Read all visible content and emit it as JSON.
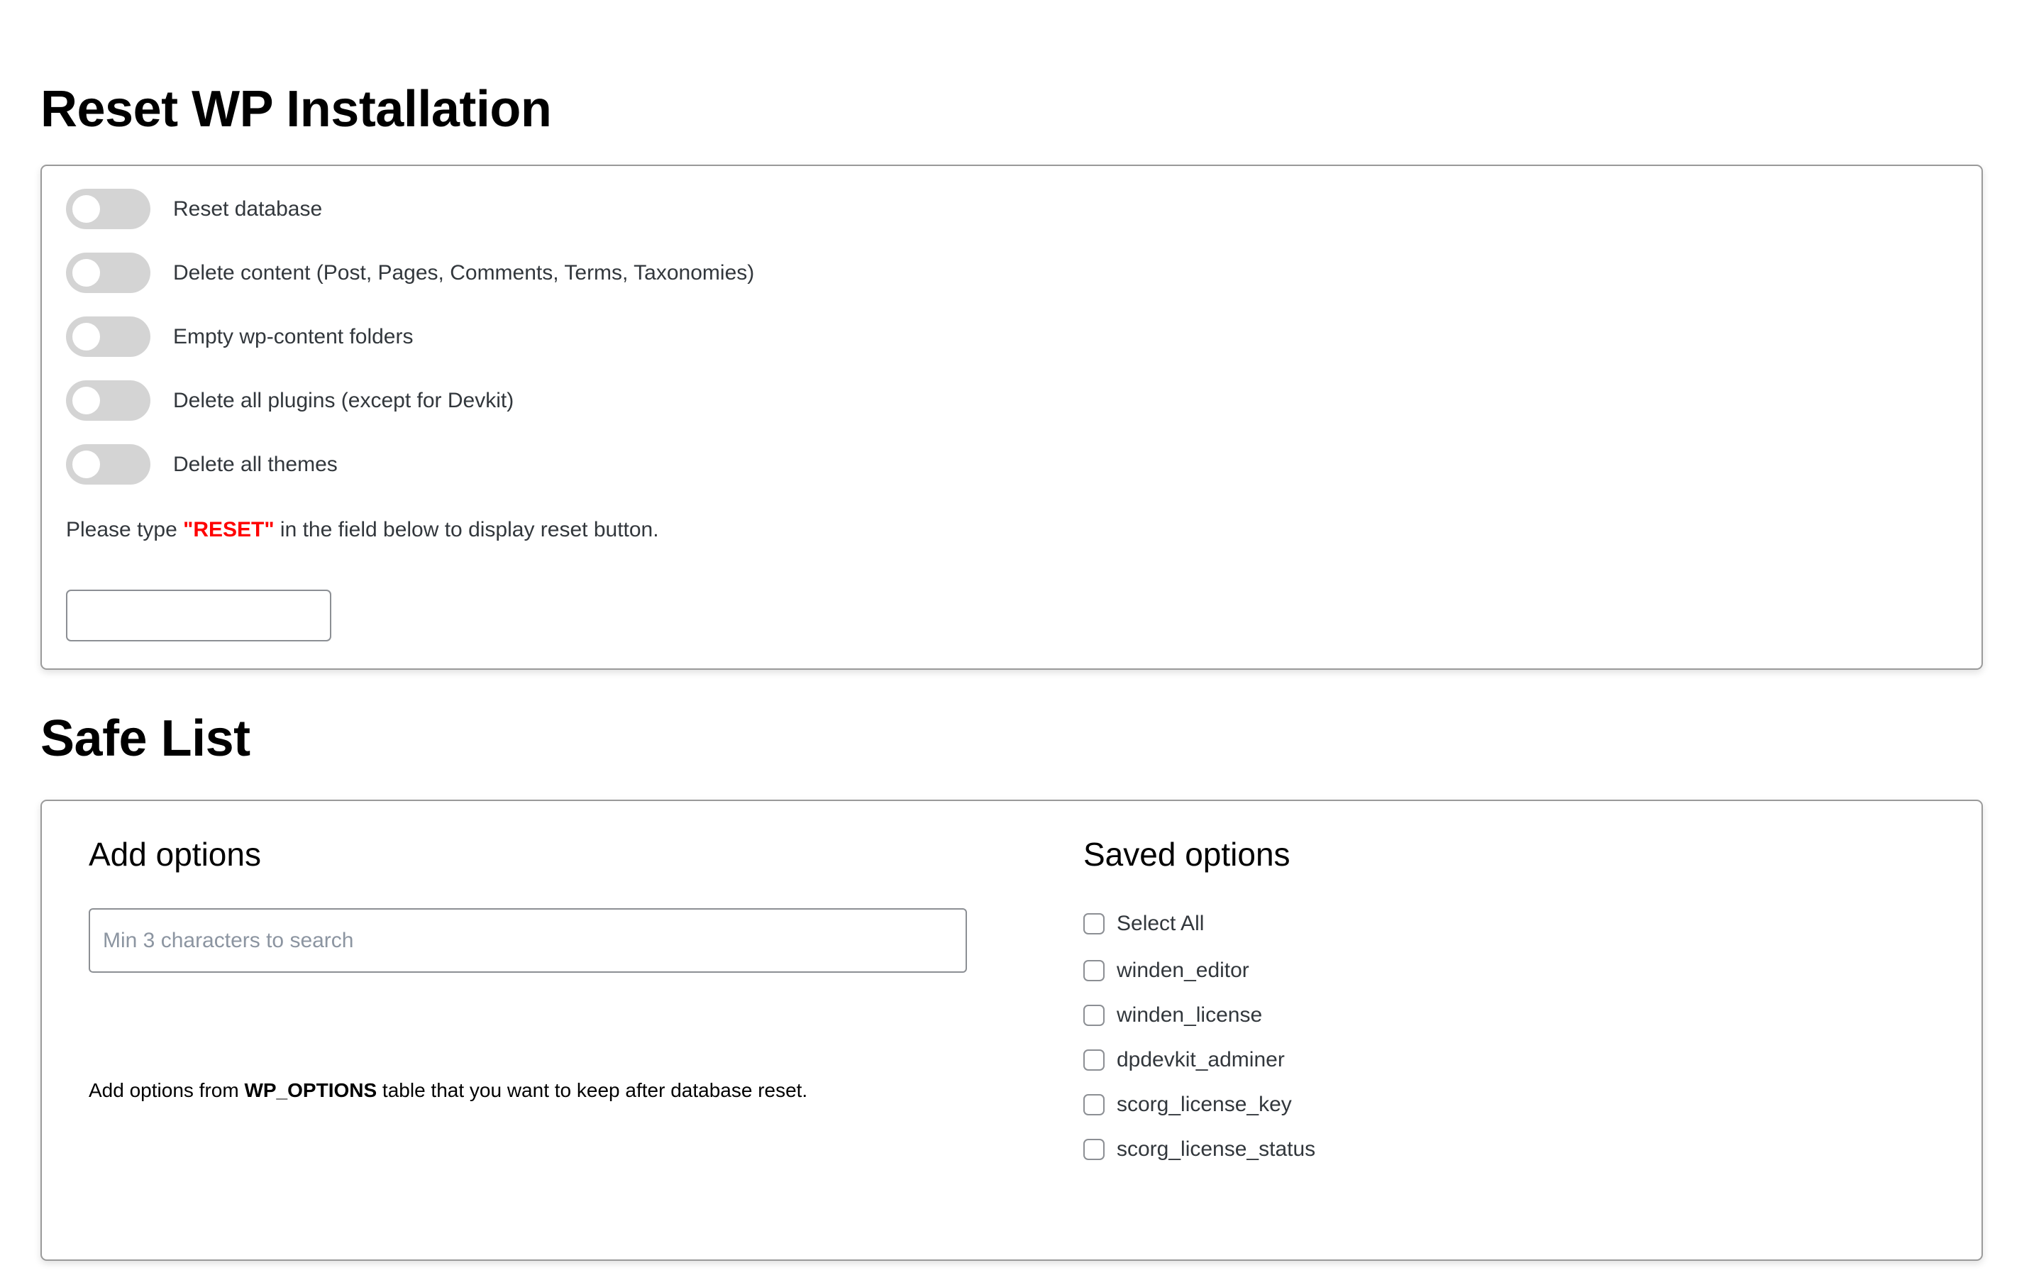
{
  "reset_section": {
    "title": "Reset WP Installation",
    "toggles": [
      {
        "label": "Reset database",
        "on": false
      },
      {
        "label": "Delete content (Post, Pages, Comments, Terms, Taxonomies)",
        "on": false
      },
      {
        "label": "Empty wp-content folders",
        "on": false
      },
      {
        "label": "Delete all plugins (except for Devkit)",
        "on": false
      },
      {
        "label": "Delete all themes",
        "on": false
      }
    ],
    "instruction_prefix": "Please type ",
    "instruction_keyword": "\"RESET\"",
    "instruction_suffix": " in the field below to display reset button.",
    "confirm_input_value": "",
    "accent_color": "#ff0000"
  },
  "safe_list": {
    "title": "Safe List",
    "add_options": {
      "heading": "Add options",
      "search_placeholder": "Min 3 characters to search",
      "search_value": "",
      "help_prefix": "Add options from ",
      "help_bold": "WP_OPTIONS",
      "help_suffix": " table that you want to keep after database reset."
    },
    "saved_options": {
      "heading": "Saved options",
      "select_all_label": "Select All",
      "items": [
        {
          "label": "winden_editor",
          "checked": false
        },
        {
          "label": "winden_license",
          "checked": false
        },
        {
          "label": "dpdevkit_adminer",
          "checked": false
        },
        {
          "label": "scorg_license_key",
          "checked": false
        },
        {
          "label": "scorg_license_status",
          "checked": false
        }
      ]
    }
  }
}
